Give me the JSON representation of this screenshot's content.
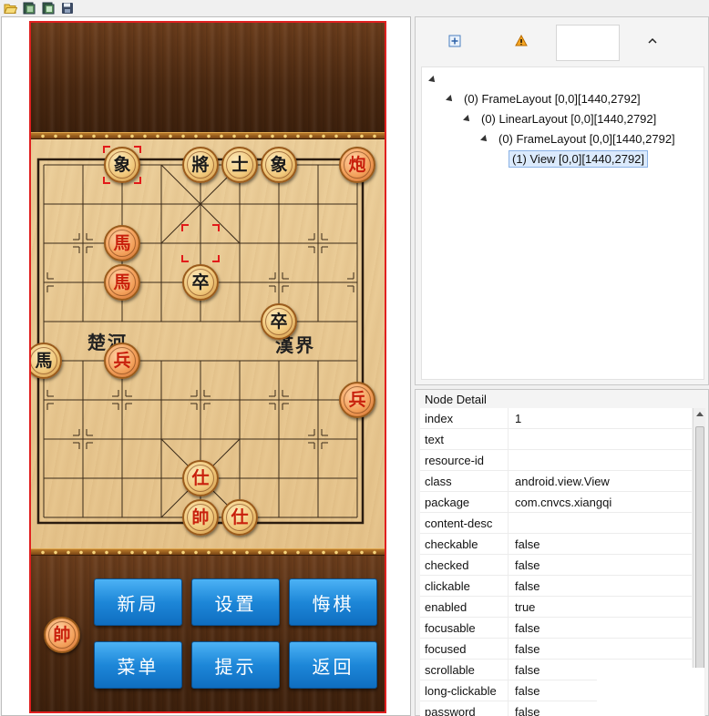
{
  "toolbar": {
    "icons": [
      "open-folder-icon",
      "device-screenshot-icon",
      "device-screenshot-compressed-icon",
      "save-icon"
    ]
  },
  "game": {
    "buttons": [
      "新局",
      "设置",
      "悔棋",
      "菜单",
      "提示",
      "返回"
    ],
    "river_left": "楚河",
    "river_right": "漢界",
    "pieces": [
      {
        "char": "象",
        "side": "black",
        "col": 2,
        "row": 0
      },
      {
        "char": "將",
        "side": "black",
        "col": 4,
        "row": 0
      },
      {
        "char": "士",
        "side": "black",
        "col": 5,
        "row": 0
      },
      {
        "char": "象",
        "side": "black",
        "col": 6,
        "row": 0
      },
      {
        "char": "炮",
        "side": "red",
        "col": 8,
        "row": 0,
        "redbg": true
      },
      {
        "char": "馬",
        "side": "red",
        "col": 2,
        "row": 2,
        "redbg": true
      },
      {
        "char": "馬",
        "side": "red",
        "col": 2,
        "row": 3,
        "redbg": true
      },
      {
        "char": "卒",
        "side": "black",
        "col": 4,
        "row": 3
      },
      {
        "char": "卒",
        "side": "black",
        "col": 6,
        "row": 4
      },
      {
        "char": "馬",
        "side": "black",
        "col": 0,
        "row": 5
      },
      {
        "char": "兵",
        "side": "red",
        "col": 2,
        "row": 5,
        "redbg": true
      },
      {
        "char": "兵",
        "side": "red",
        "col": 8,
        "row": 6,
        "redbg": true
      },
      {
        "char": "仕",
        "side": "red",
        "col": 4,
        "row": 8
      },
      {
        "char": "帥",
        "side": "red",
        "col": 4,
        "row": 9
      },
      {
        "char": "仕",
        "side": "red",
        "col": 5,
        "row": 9
      }
    ],
    "captured_piece": "帥",
    "selections": [
      {
        "col": 2,
        "row": 0
      },
      {
        "col": 4,
        "row": 2
      }
    ]
  },
  "tree": {
    "rows": [
      {
        "label": "",
        "depth": 0
      },
      {
        "label": "(0) FrameLayout [0,0][1440,2792]",
        "depth": 1
      },
      {
        "label": "(0) LinearLayout [0,0][1440,2792]",
        "depth": 2
      },
      {
        "label": "(0) FrameLayout [0,0][1440,2792]",
        "depth": 3
      },
      {
        "label": "(1) View [0,0][1440,2792]",
        "depth": 4,
        "selected": true
      }
    ]
  },
  "detail": {
    "title": "Node Detail",
    "rows": [
      [
        "index",
        "1"
      ],
      [
        "text",
        ""
      ],
      [
        "resource-id",
        ""
      ],
      [
        "class",
        "android.view.View"
      ],
      [
        "package",
        "com.cnvcs.xiangqi"
      ],
      [
        "content-desc",
        ""
      ],
      [
        "checkable",
        "false"
      ],
      [
        "checked",
        "false"
      ],
      [
        "clickable",
        "false"
      ],
      [
        "enabled",
        "true"
      ],
      [
        "focusable",
        "false"
      ],
      [
        "focused",
        "false"
      ],
      [
        "scrollable",
        "false"
      ],
      [
        "long-clickable",
        "false"
      ],
      [
        "password",
        "false"
      ]
    ]
  }
}
